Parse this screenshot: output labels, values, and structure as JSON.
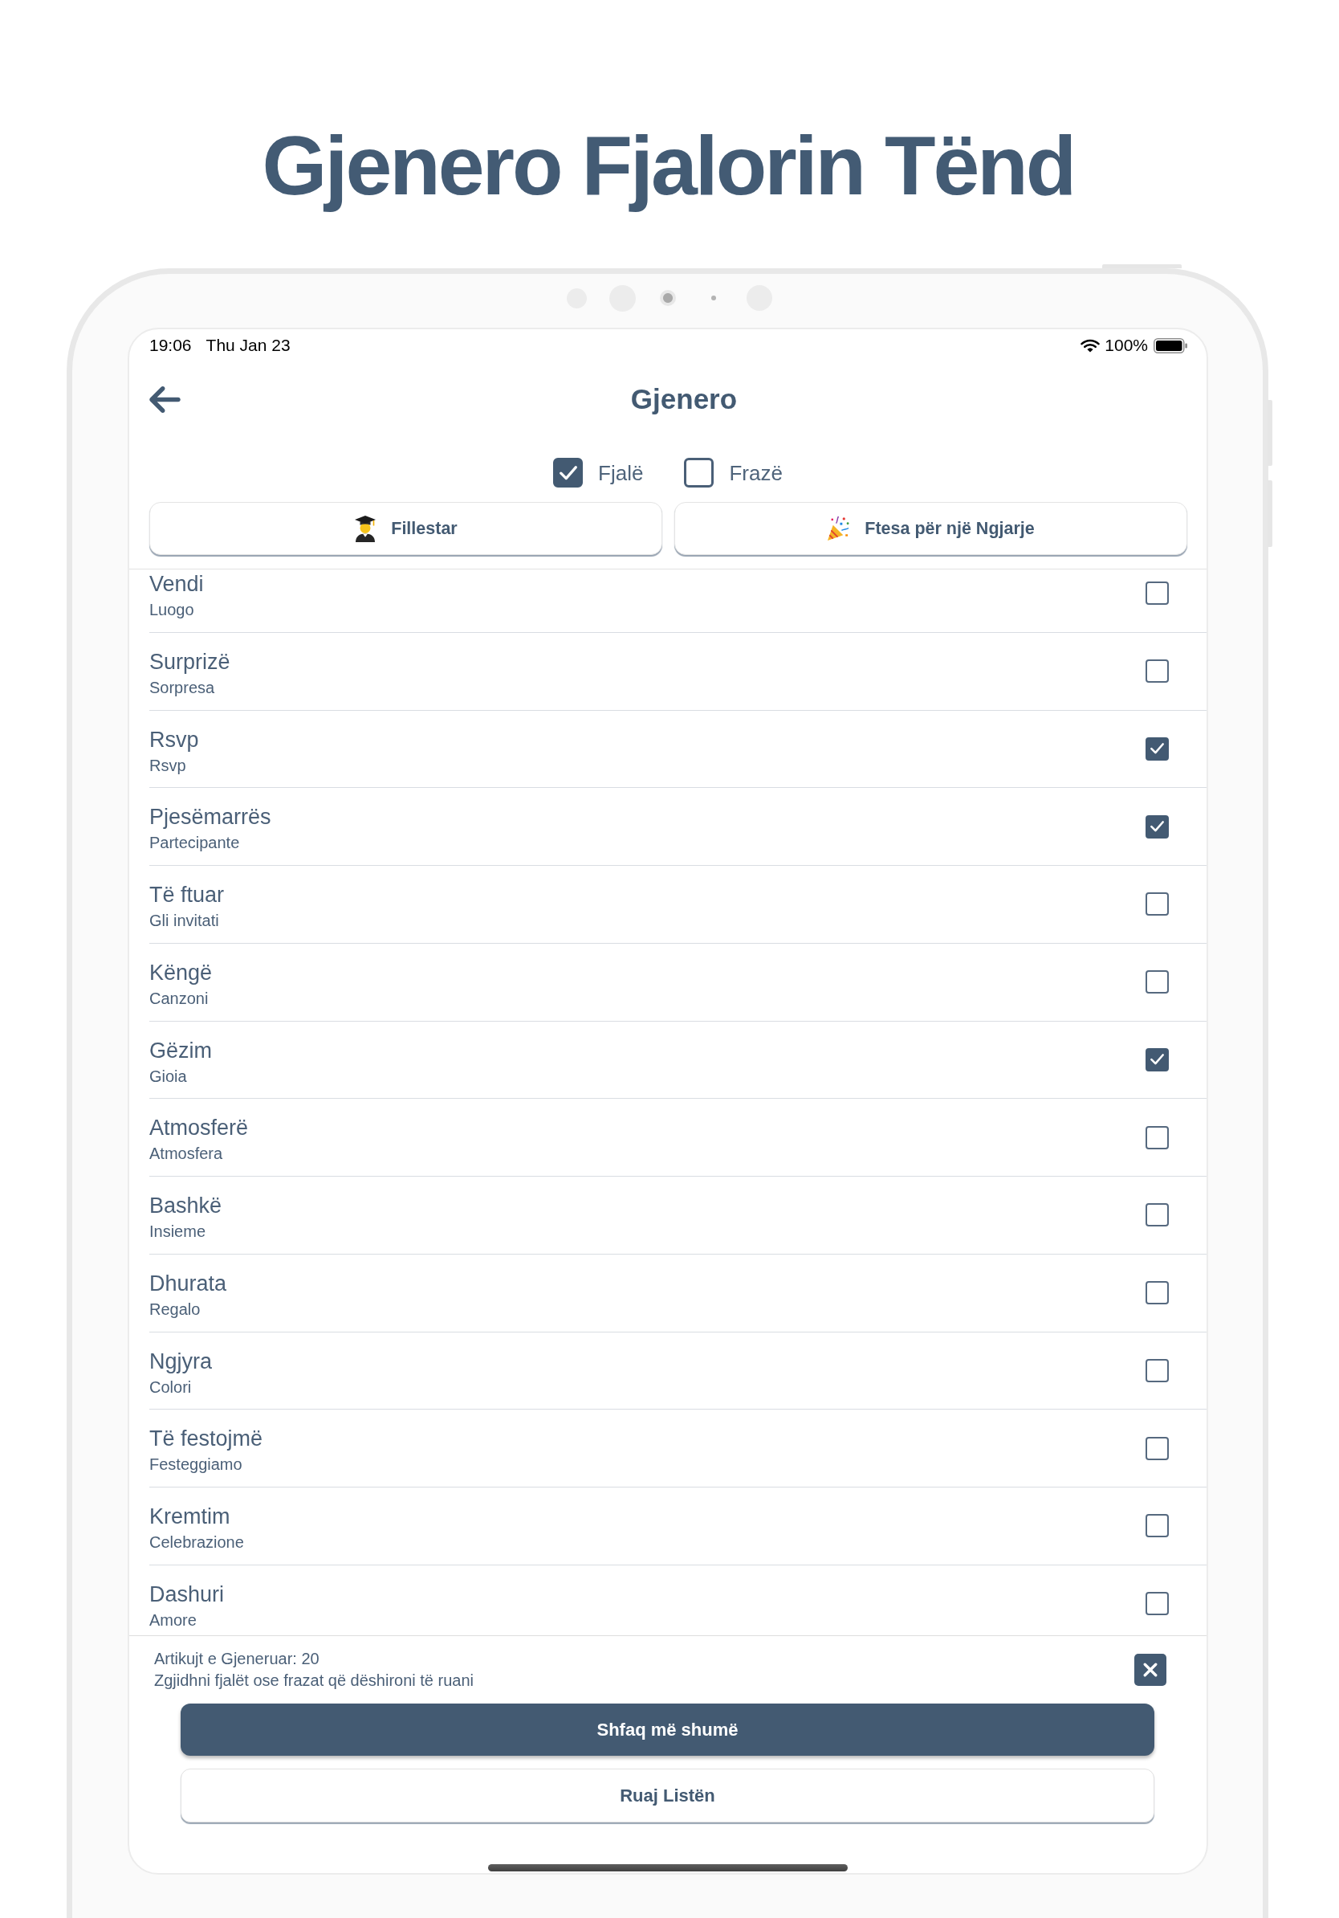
{
  "page_title": "Gjenero Fjalorin Tënd",
  "status_bar": {
    "time": "19:06",
    "date": "Thu Jan 23",
    "battery": "100%"
  },
  "header": {
    "title": "Gjenero"
  },
  "type_filters": [
    {
      "label": "Fjalë",
      "checked": true
    },
    {
      "label": "Frazë",
      "checked": false
    }
  ],
  "categories": [
    {
      "label": "Fillestar"
    },
    {
      "label": "Ftesa për një Ngjarje"
    }
  ],
  "items": [
    {
      "word": "Vendi",
      "translation": "Luogo",
      "checked": false
    },
    {
      "word": "Surprizë",
      "translation": "Sorpresa",
      "checked": false
    },
    {
      "word": "Rsvp",
      "translation": "Rsvp",
      "checked": true
    },
    {
      "word": "Pjesëmarrës",
      "translation": "Partecipante",
      "checked": true
    },
    {
      "word": "Të ftuar",
      "translation": "Gli invitati",
      "checked": false
    },
    {
      "word": "Këngë",
      "translation": "Canzoni",
      "checked": false
    },
    {
      "word": "Gëzim",
      "translation": "Gioia",
      "checked": true
    },
    {
      "word": "Atmosferë",
      "translation": "Atmosfera",
      "checked": false
    },
    {
      "word": "Bashkë",
      "translation": "Insieme",
      "checked": false
    },
    {
      "word": "Dhurata",
      "translation": "Regalo",
      "checked": false
    },
    {
      "word": "Ngjyra",
      "translation": "Colori",
      "checked": false
    },
    {
      "word": "Të festojmë",
      "translation": "Festeggiamo",
      "checked": false
    },
    {
      "word": "Kremtim",
      "translation": "Celebrazione",
      "checked": false
    },
    {
      "word": "Dashuri",
      "translation": "Amore",
      "checked": false
    }
  ],
  "footer": {
    "count": "Artikujt e Gjeneruar: 20",
    "hint": "Zgjidhni fjalët ose frazat që dëshironi të ruani"
  },
  "buttons": [
    {
      "label": "Shfaq më shumë",
      "kind": "primary"
    },
    {
      "label": "Ruaj Listën",
      "kind": "secondary"
    }
  ]
}
